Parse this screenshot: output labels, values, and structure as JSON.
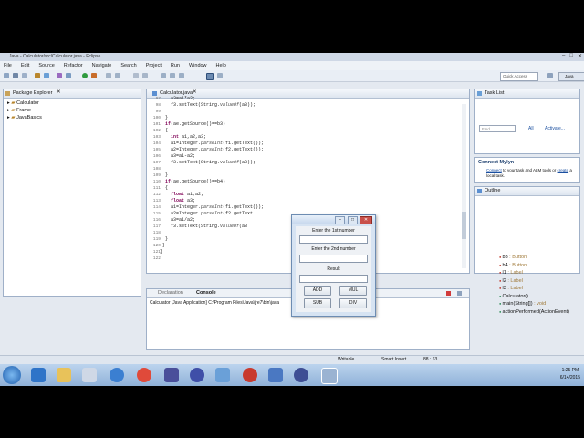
{
  "window": {
    "title": "Java - Calculator/src/Calculator.java - Eclipse",
    "controls": [
      "–",
      "□",
      "✕"
    ]
  },
  "menu": [
    "File",
    "Edit",
    "Source",
    "Refactor",
    "Navigate",
    "Search",
    "Project",
    "Run",
    "Window",
    "Help"
  ],
  "toolbar": {
    "quick_access": "Quick Access",
    "perspective": "Java"
  },
  "package_explorer": {
    "title": "Package Explorer",
    "items": [
      "Calculator",
      "Frame",
      "JavaBasics"
    ]
  },
  "editor": {
    "tab": "Calculator.java",
    "lines": [
      {
        "n": "97",
        "text": "    a3=a1*a2;"
      },
      {
        "n": "98",
        "text": "    f3.setText(String.valueOf(a3));"
      },
      {
        "n": "99",
        "text": ""
      },
      {
        "n": "100",
        "text": "  }"
      },
      {
        "n": "101",
        "text": "  if(ae.getSource()==b3)"
      },
      {
        "n": "102",
        "text": "  {"
      },
      {
        "n": "103",
        "text": "    int a1,a2,a3;"
      },
      {
        "n": "104",
        "text": "    a1=Integer.parseInt(f1.getText());"
      },
      {
        "n": "105",
        "text": "    a2=Integer.parseInt(f2.getText());"
      },
      {
        "n": "106",
        "text": "    a3=a1-a2;"
      },
      {
        "n": "107",
        "text": "    f3.setText(String.valueOf(a3));"
      },
      {
        "n": "108",
        "text": ""
      },
      {
        "n": "109",
        "text": "  }"
      },
      {
        "n": "110",
        "text": "  if(ae.getSource()==b4)"
      },
      {
        "n": "111",
        "text": "  {"
      },
      {
        "n": "112",
        "text": "    float a1,a2;"
      },
      {
        "n": "113",
        "text": "    float a3;"
      },
      {
        "n": "114",
        "text": "    a1=Integer.parseInt(f1.getText());"
      },
      {
        "n": "115",
        "text": "    a2=Integer.parseInt(f2.getText"
      },
      {
        "n": "116",
        "text": "    a3=a1/a2;"
      },
      {
        "n": "117",
        "text": "    f3.setText(String.valueOf(a3"
      },
      {
        "n": "118",
        "text": ""
      },
      {
        "n": "119",
        "text": "  }"
      },
      {
        "n": "120",
        "text": " }"
      },
      {
        "n": "121",
        "text": "}"
      },
      {
        "n": "122",
        "text": ""
      }
    ]
  },
  "console": {
    "tabs": [
      "Declaration",
      "Console"
    ],
    "text": "Calculator [Java Application] C:\\Program Files\\Java\\jre7\\bin\\java"
  },
  "task_list": {
    "title": "Task List",
    "find_placeholder": "Find",
    "all": "All",
    "activate": "Activate..."
  },
  "mylyn": {
    "title": "Connect Mylyn",
    "text_a": "Connect",
    "text_b": " to your task and ALM tools or ",
    "text_c": "create",
    "text_d": " a local task."
  },
  "outline": {
    "title": "Outline",
    "items": [
      {
        "name": "b3",
        "type": " : Button",
        "color": "#c0392b"
      },
      {
        "name": "b4",
        "type": " : Button",
        "color": "#c0392b"
      },
      {
        "name": "l1",
        "type": " : Label",
        "color": "#c0392b"
      },
      {
        "name": "l2",
        "type": " : Label",
        "color": "#c0392b"
      },
      {
        "name": "l3",
        "type": " : Label",
        "color": "#c0392b"
      },
      {
        "name": "Calculator()",
        "type": "",
        "color": "#2e8b57"
      },
      {
        "name": "main(String[])",
        "type": " : void",
        "color": "#2e8b57"
      },
      {
        "name": "actionPerformed(ActionEvent)",
        "type": "",
        "color": "#2e8b57"
      }
    ]
  },
  "status": {
    "writable": "Writable",
    "insert": "Smart Insert",
    "position": "88 : 63"
  },
  "clock": {
    "time": "1:25 PM",
    "date": "6/14/2015"
  },
  "calculator": {
    "label1": "Enter the 1st number",
    "label2": "Enter the 2nd number",
    "label3": "Result",
    "add": "ADD",
    "mul": "MUL",
    "sub": "SUB",
    "div": "DIV"
  }
}
